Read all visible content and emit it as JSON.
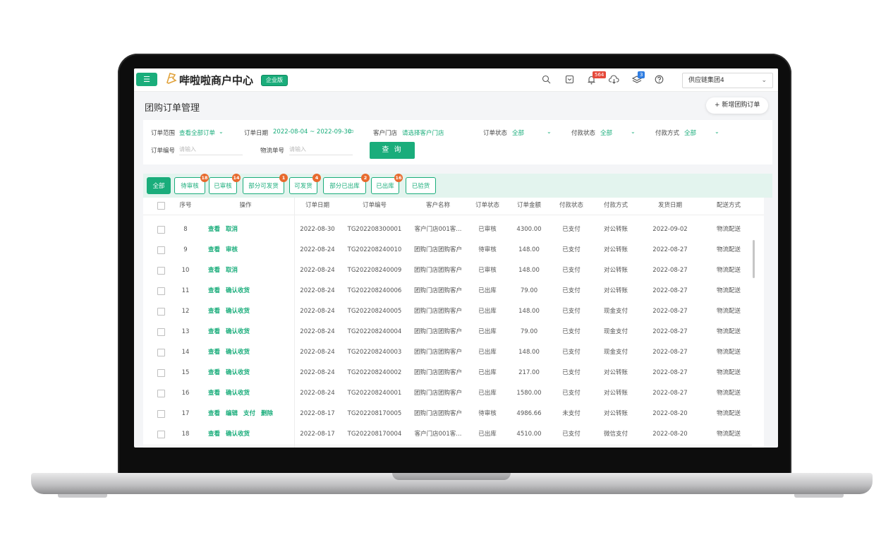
{
  "header": {
    "menu_icon": "☰",
    "brand": "哔啦啦商户中心",
    "edition": "企业版",
    "notif_count": "564",
    "cloud_count": "",
    "layers_count": "3",
    "org_name": "供应链集团4"
  },
  "page": {
    "title": "团购订单管理",
    "new_button": "+ 新增团购订单"
  },
  "filters": {
    "scope_label": "订单范围",
    "scope_value": "查看全部订单",
    "date_label": "订单日期",
    "date_value": "2022-08-04 ~ 2022-09-30",
    "store_label": "客户门店",
    "store_value": "请选择客户门店",
    "status_label": "订单状态",
    "status_value": "全部",
    "pay_status_label": "付款状态",
    "pay_status_value": "全部",
    "pay_method_label": "付款方式",
    "pay_method_value": "全部",
    "order_no_label": "订单编号",
    "order_no_placeholder": "请输入",
    "logistics_label": "物流单号",
    "logistics_placeholder": "请输入",
    "query_button": "查 询"
  },
  "tabs": [
    {
      "label": "全部",
      "badge": ""
    },
    {
      "label": "待审核",
      "badge": "18"
    },
    {
      "label": "已审核",
      "badge": "14"
    },
    {
      "label": "部分可发货",
      "badge": "1"
    },
    {
      "label": "可发货",
      "badge": "4"
    },
    {
      "label": "部分已出库",
      "badge": "2"
    },
    {
      "label": "已出库",
      "badge": "16"
    },
    {
      "label": "已验货",
      "badge": ""
    }
  ],
  "columns": [
    "序号",
    "操作",
    "订单日期",
    "订单编号",
    "客户名称",
    "订单状态",
    "订单金额",
    "付款状态",
    "付款方式",
    "发货日期",
    "配送方式"
  ],
  "rows": [
    {
      "no": "8",
      "actions": [
        "查看",
        "取消"
      ],
      "date": "2022-08-30",
      "order": "TG202208300001",
      "customer": "客户门店001客...",
      "status": "已审核",
      "amount": "4300.00",
      "pay": "已支付",
      "method": "对公转账",
      "ship": "2022-09-02",
      "delivery": "物流配送"
    },
    {
      "no": "9",
      "actions": [
        "查看",
        "审核"
      ],
      "date": "2022-08-24",
      "order": "TG202208240010",
      "customer": "团购门店团购客户",
      "status": "待审核",
      "amount": "148.00",
      "pay": "已支付",
      "method": "对公转账",
      "ship": "2022-08-27",
      "delivery": "物流配送"
    },
    {
      "no": "10",
      "actions": [
        "查看",
        "取消"
      ],
      "date": "2022-08-24",
      "order": "TG202208240009",
      "customer": "团购门店团购客户",
      "status": "已审核",
      "amount": "148.00",
      "pay": "已支付",
      "method": "对公转账",
      "ship": "2022-08-27",
      "delivery": "物流配送"
    },
    {
      "no": "11",
      "actions": [
        "查看",
        "确认收货"
      ],
      "date": "2022-08-24",
      "order": "TG202208240006",
      "customer": "团购门店团购客户",
      "status": "已出库",
      "amount": "79.00",
      "pay": "已支付",
      "method": "对公转账",
      "ship": "2022-08-27",
      "delivery": "物流配送"
    },
    {
      "no": "12",
      "actions": [
        "查看",
        "确认收货"
      ],
      "date": "2022-08-24",
      "order": "TG202208240005",
      "customer": "团购门店团购客户",
      "status": "已出库",
      "amount": "148.00",
      "pay": "已支付",
      "method": "现金支付",
      "ship": "2022-08-27",
      "delivery": "物流配送"
    },
    {
      "no": "13",
      "actions": [
        "查看",
        "确认收货"
      ],
      "date": "2022-08-24",
      "order": "TG202208240004",
      "customer": "团购门店团购客户",
      "status": "已出库",
      "amount": "79.00",
      "pay": "已支付",
      "method": "现金支付",
      "ship": "2022-08-27",
      "delivery": "物流配送"
    },
    {
      "no": "14",
      "actions": [
        "查看",
        "确认收货"
      ],
      "date": "2022-08-24",
      "order": "TG202208240003",
      "customer": "团购门店团购客户",
      "status": "已出库",
      "amount": "148.00",
      "pay": "已支付",
      "method": "现金支付",
      "ship": "2022-08-27",
      "delivery": "物流配送"
    },
    {
      "no": "15",
      "actions": [
        "查看",
        "确认收货"
      ],
      "date": "2022-08-24",
      "order": "TG202208240002",
      "customer": "团购门店团购客户",
      "status": "已出库",
      "amount": "217.00",
      "pay": "已支付",
      "method": "对公转账",
      "ship": "2022-08-27",
      "delivery": "物流配送"
    },
    {
      "no": "16",
      "actions": [
        "查看",
        "确认收货"
      ],
      "date": "2022-08-24",
      "order": "TG202208240001",
      "customer": "团购门店团购客户",
      "status": "已出库",
      "amount": "1580.00",
      "pay": "已支付",
      "method": "对公转账",
      "ship": "2022-08-27",
      "delivery": "物流配送"
    },
    {
      "no": "17",
      "actions": [
        "查看",
        "编辑",
        "支付",
        "删除"
      ],
      "date": "2022-08-17",
      "order": "TG202208170005",
      "customer": "团购门店团购客户",
      "status": "待审核",
      "amount": "4986.66",
      "pay": "未支付",
      "method": "对公转账",
      "ship": "2022-08-20",
      "delivery": "物流配送"
    },
    {
      "no": "18",
      "actions": [
        "查看",
        "确认收货"
      ],
      "date": "2022-08-17",
      "order": "TG202208170004",
      "customer": "客户门店001客...",
      "status": "已出库",
      "amount": "4510.00",
      "pay": "已支付",
      "method": "微信支付",
      "ship": "2022-08-20",
      "delivery": "物流配送"
    }
  ],
  "colors": {
    "accent": "#1aad7b",
    "badge": "#e86a2e"
  }
}
